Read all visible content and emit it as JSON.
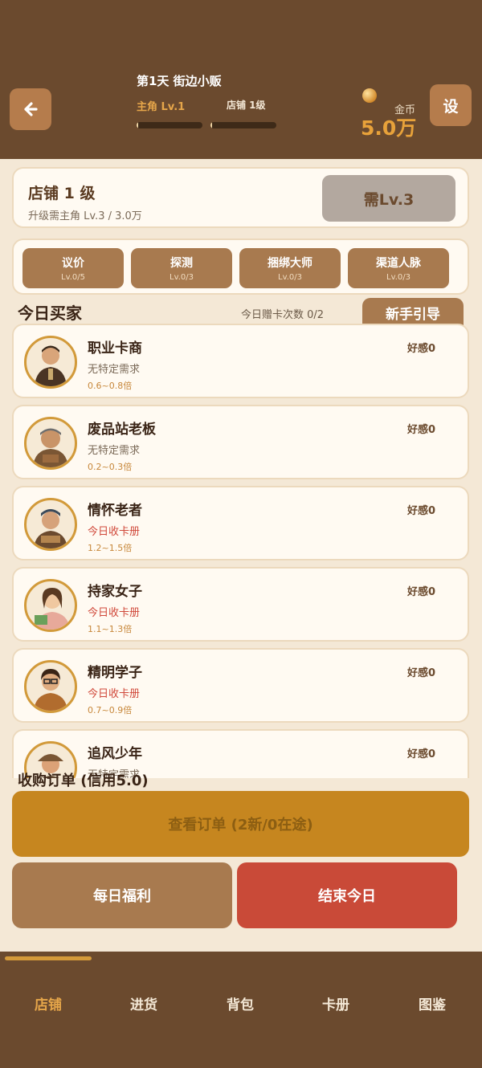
{
  "header": {
    "day_title": "第1天 街边小贩",
    "hero_level": "主角 Lv.1",
    "shop_level": "店铺 1级",
    "hero_exp_progress": 0.02,
    "shop_exp_progress": 0.02,
    "coin_label": "金币",
    "coin_value": "5.0万",
    "settings_label": "设"
  },
  "shop": {
    "name": "店铺 1 级",
    "requirement": "升级需主角 Lv.3 / 3.0万",
    "upgrade_label": "需Lv.3"
  },
  "skills": [
    {
      "name": "议价",
      "level": "Lv.0/5"
    },
    {
      "name": "探测",
      "level": "Lv.0/3"
    },
    {
      "name": "捆绑大师",
      "level": "Lv.0/3"
    },
    {
      "name": "渠道人脉",
      "level": "Lv.0/3"
    }
  ],
  "buyers_section": {
    "title": "今日买家",
    "gift_count": "今日赠卡次数 0/2",
    "guide_label": "新手引导"
  },
  "buyers": [
    {
      "name": "职业卡商",
      "need": "无特定需求",
      "multiplier": "0.6~0.8倍",
      "favor": "好感0"
    },
    {
      "name": "废品站老板",
      "need": "无特定需求",
      "multiplier": "0.2~0.3倍",
      "favor": "好感0"
    },
    {
      "name": "情怀老者",
      "need": "今日收卡册",
      "multiplier": "1.2~1.5倍",
      "favor": "好感0"
    },
    {
      "name": "持家女子",
      "need": "今日收卡册",
      "multiplier": "1.1~1.3倍",
      "favor": "好感0"
    },
    {
      "name": "精明学子",
      "need": "今日收卡册",
      "multiplier": "0.7~0.9倍",
      "favor": "好感0"
    },
    {
      "name": "追风少年",
      "need": "无特定需求",
      "multiplier": "",
      "favor": "好感0"
    }
  ],
  "orders": {
    "title": "收购订单 (信用5.0)",
    "view_label": "查看订单 (2新/0在途)",
    "daily_label": "每日福利",
    "end_label": "结束今日"
  },
  "nav": [
    {
      "label": "店铺",
      "active": true
    },
    {
      "label": "进货",
      "active": false
    },
    {
      "label": "背包",
      "active": false
    },
    {
      "label": "卡册",
      "active": false
    },
    {
      "label": "图鉴",
      "active": false
    }
  ]
}
